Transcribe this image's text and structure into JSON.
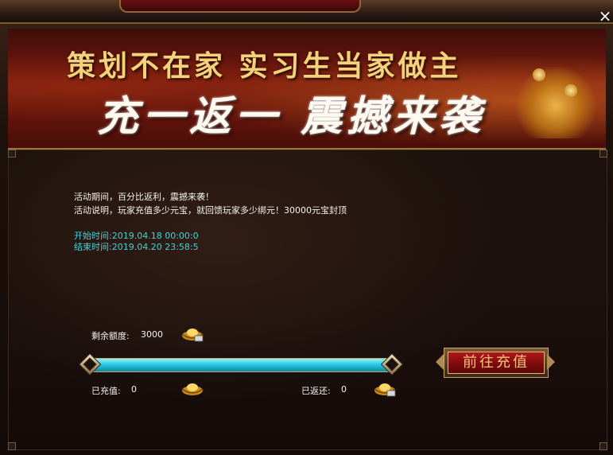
{
  "window": {
    "close_glyph": "×"
  },
  "banner": {
    "title_line1": "策划不在家 实习生当家做主",
    "title_line2": "充一返一 震撼来袭"
  },
  "description": {
    "line1": "活动期间，百分比返利，震撼来袭！",
    "line2": "活动说明，玩家充值多少元宝，就回馈玩家多少绑元！30000元宝封顶"
  },
  "schedule": {
    "start_label": "开始时间:",
    "start_value": "2019.04.18 00:00:0",
    "end_label": "结束时间:",
    "end_value": "2019.04.20 23:58:5"
  },
  "quota": {
    "remaining_label": "剩余额度:",
    "remaining_value": "3000",
    "progress": 1.0
  },
  "charged": {
    "label": "已充值:",
    "value": "0"
  },
  "returned": {
    "label": "已返还:",
    "value": "0"
  },
  "recharge_button": {
    "label": "前往充值"
  },
  "colors": {
    "accent_cyan": "#3fd3d8",
    "bar_fill": "#22c4dd",
    "button_red": "#b01818"
  },
  "icons": [
    "close-icon",
    "gold-ingot-icon",
    "arrow-left-icon",
    "arrow-right-icon"
  ]
}
